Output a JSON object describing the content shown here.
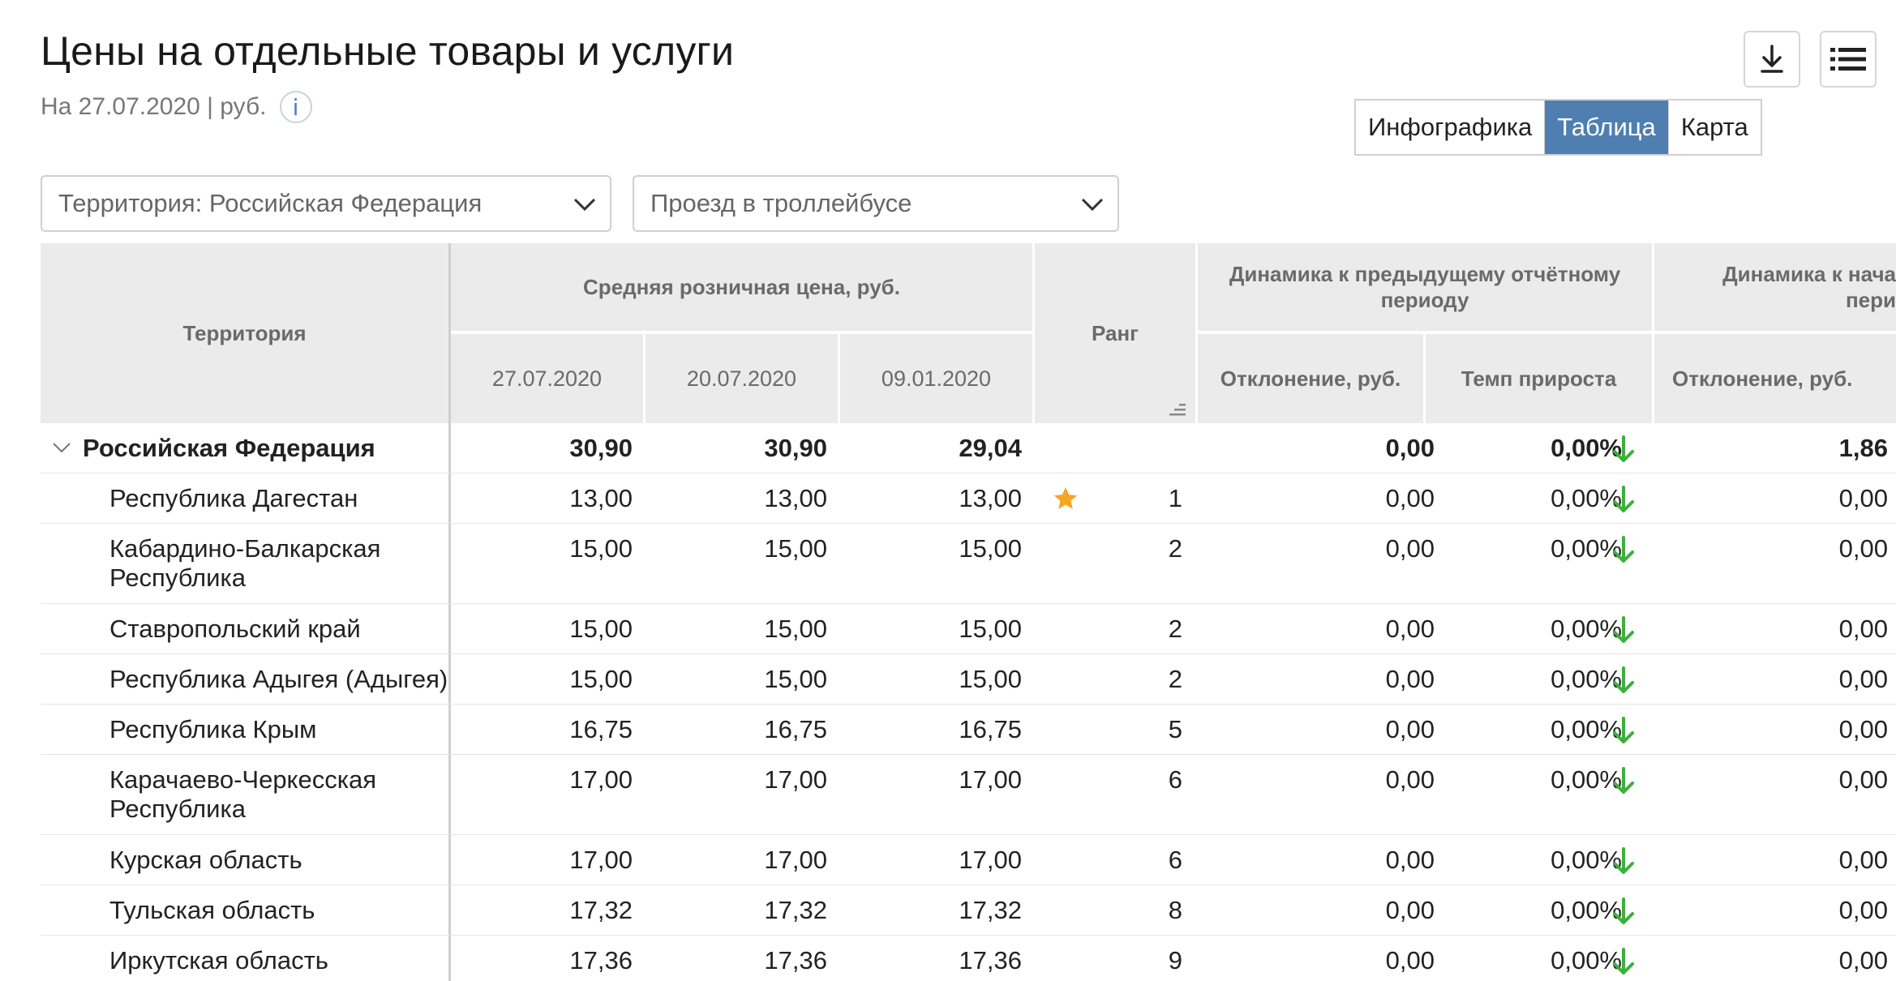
{
  "page": {
    "title": "Цены на отдельные товары и услуги",
    "subtitle": "На 27.07.2020 | руб.",
    "info_icon": "i"
  },
  "toolbar": {
    "download_icon": "download-icon",
    "menu_icon": "list-menu-icon"
  },
  "view_toggle": {
    "options": [
      "Инфографика",
      "Таблица",
      "Карта"
    ],
    "active": "Таблица"
  },
  "filters": {
    "territory": "Территория: Российская  Федерация",
    "product": "Проезд в троллейбусе"
  },
  "table": {
    "headers": {
      "territory": "Территория",
      "avg_price": "Средняя розничная цена, руб.",
      "dates": [
        "27.07.2020",
        "20.07.2020",
        "09.01.2020"
      ],
      "rank": "Ранг",
      "dyn_prev_line1": "Динамика к предыдущему отчётному",
      "dyn_prev_line2": "периоду",
      "dyn_prev_dev": "Отклонение, руб.",
      "dyn_prev_rate": "Темп прироста",
      "dyn_start_line1": "Динамика к нача",
      "dyn_start_line2": "пери",
      "dyn_start_dev": "Отклонение, руб."
    },
    "total": {
      "name": "Российская Федерация",
      "p1": "30,90",
      "p2": "30,90",
      "p3": "29,04",
      "dev": "0,00",
      "rate": "0,00%",
      "dev2": "1,86"
    },
    "rows": [
      {
        "name": [
          "Республика Дагестан"
        ],
        "p1": "13,00",
        "p2": "13,00",
        "p3": "13,00",
        "rank": "1",
        "dev": "0,00",
        "rate": "0,00%",
        "dev2": "0,00",
        "star": true
      },
      {
        "name": [
          "Кабардино-Балкарская",
          "Республика"
        ],
        "p1": "15,00",
        "p2": "15,00",
        "p3": "15,00",
        "rank": "2",
        "dev": "0,00",
        "rate": "0,00%",
        "dev2": "0,00"
      },
      {
        "name": [
          "Ставропольский край"
        ],
        "p1": "15,00",
        "p2": "15,00",
        "p3": "15,00",
        "rank": "2",
        "dev": "0,00",
        "rate": "0,00%",
        "dev2": "0,00"
      },
      {
        "name": [
          "Республика Адыгея (Адыгея)"
        ],
        "p1": "15,00",
        "p2": "15,00",
        "p3": "15,00",
        "rank": "2",
        "dev": "0,00",
        "rate": "0,00%",
        "dev2": "0,00"
      },
      {
        "name": [
          "Республика Крым"
        ],
        "p1": "16,75",
        "p2": "16,75",
        "p3": "16,75",
        "rank": "5",
        "dev": "0,00",
        "rate": "0,00%",
        "dev2": "0,00"
      },
      {
        "name": [
          "Карачаево-Черкесская",
          "Республика"
        ],
        "p1": "17,00",
        "p2": "17,00",
        "p3": "17,00",
        "rank": "6",
        "dev": "0,00",
        "rate": "0,00%",
        "dev2": "0,00"
      },
      {
        "name": [
          "Курская область"
        ],
        "p1": "17,00",
        "p2": "17,00",
        "p3": "17,00",
        "rank": "6",
        "dev": "0,00",
        "rate": "0,00%",
        "dev2": "0,00"
      },
      {
        "name": [
          "Тульская область"
        ],
        "p1": "17,32",
        "p2": "17,32",
        "p3": "17,32",
        "rank": "8",
        "dev": "0,00",
        "rate": "0,00%",
        "dev2": "0,00"
      },
      {
        "name": [
          "Иркутская область"
        ],
        "p1": "17,36",
        "p2": "17,36",
        "p3": "17,36",
        "rank": "9",
        "dev": "0,00",
        "rate": "0,00%",
        "dev2": "0,00"
      }
    ],
    "colors": {
      "header_bg": "#ebebeb",
      "arrow_down": "#3cb03c",
      "star": "#f5a623",
      "active_tab": "#4f7fb0"
    }
  }
}
